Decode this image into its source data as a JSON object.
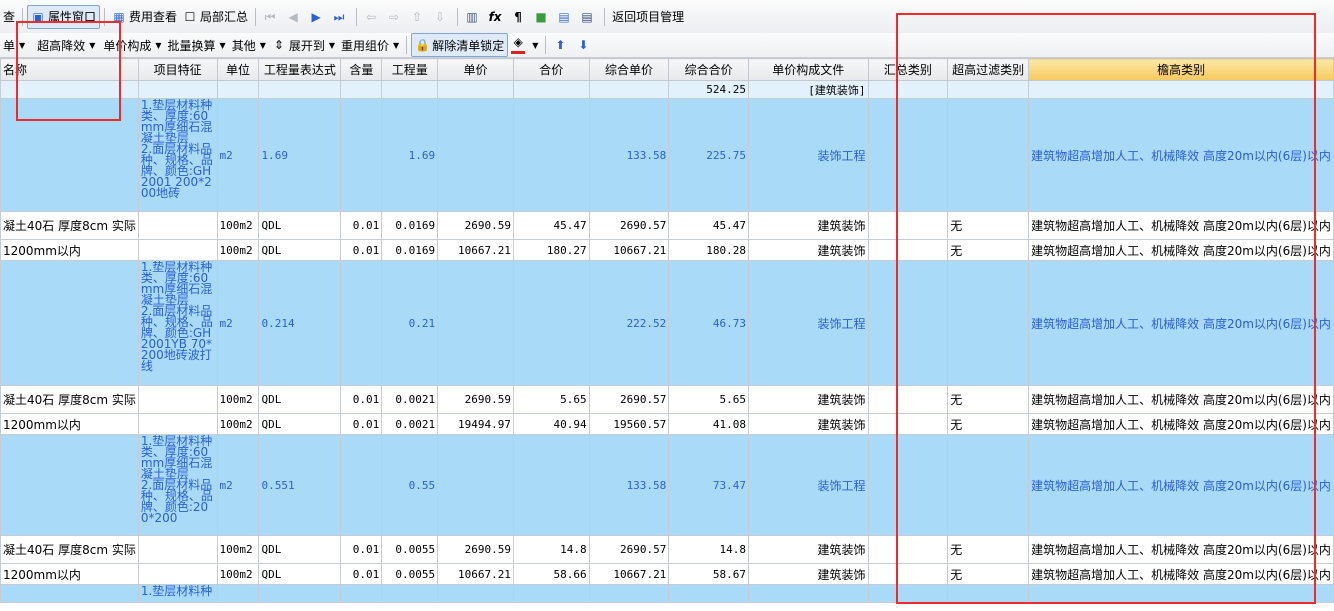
{
  "toolbar1": {
    "items": [
      {
        "label": "查"
      },
      {
        "label": "属性窗口"
      },
      {
        "label": "费用查看"
      },
      {
        "label": "局部汇总"
      },
      {
        "label": "返回项目管理"
      }
    ]
  },
  "toolbar2": {
    "items": [
      {
        "label": "单"
      },
      {
        "label": "超高降效"
      },
      {
        "label": "单价构成"
      },
      {
        "label": "批量换算"
      },
      {
        "label": "其他"
      },
      {
        "label": "展开到"
      },
      {
        "label": "重用组价"
      },
      {
        "label": "解除清单锁定"
      }
    ]
  },
  "table": {
    "headers": [
      "名称",
      "项目特征",
      "单位",
      "工程量表达式",
      "含量",
      "工程量",
      "单价",
      "合价",
      "综合单价",
      "综合合价",
      "单价构成文件",
      "汇总类别",
      "超高过滤类别",
      "檐高类别"
    ],
    "summary": [
      "",
      "",
      "",
      "",
      "",
      "",
      "",
      "",
      "",
      "524.25",
      "[建筑装饰]",
      "",
      "",
      ""
    ],
    "rows": [
      {
        "type": "blue",
        "h": 113,
        "cells": [
          "",
          "1.垫层材料种类、厚度:60mm厚细石混凝土垫层\n2.面层材料品种、规格、品牌、颜色:GH2001 200*200地砖",
          "m2",
          "1.69",
          "",
          "1.69",
          "",
          "",
          "133.58",
          "225.75",
          "装饰工程",
          "",
          "",
          "建筑物超高增加人工、机械降效 高度20m以内(6层)以内"
        ]
      },
      {
        "type": "white",
        "h": 28,
        "cells": [
          "凝土40石 厚度8cm 实际",
          "",
          "100m2",
          "QDL",
          "0.01",
          "0.0169",
          "2690.59",
          "45.47",
          "2690.57",
          "45.47",
          "建筑装饰",
          "",
          "无",
          "建筑物超高增加人工、机械降效 高度20m以内(6层)以内"
        ]
      },
      {
        "type": "white",
        "h": 21,
        "cells": [
          "1200mm以内",
          "",
          "100m2",
          "QDL",
          "0.01",
          "0.0169",
          "10667.21",
          "180.27",
          "10667.21",
          "180.28",
          "建筑装饰",
          "",
          "无",
          "建筑物超高增加人工、机械降效 高度20m以内(6层)以内"
        ]
      },
      {
        "type": "blue",
        "h": 125,
        "cells": [
          "",
          "1.垫层材料种类、厚度:60mm厚细石混凝土垫层\n2.面层材料品种、规格、品牌、颜色:GH2001YB 70*200地砖波打线",
          "m2",
          "0.214",
          "",
          "0.21",
          "",
          "",
          "222.52",
          "46.73",
          "装饰工程",
          "",
          "",
          "建筑物超高增加人工、机械降效 高度20m以内(6层)以内"
        ]
      },
      {
        "type": "white",
        "h": 28,
        "cells": [
          "凝土40石 厚度8cm 实际",
          "",
          "100m2",
          "QDL",
          "0.01",
          "0.0021",
          "2690.59",
          "5.65",
          "2690.57",
          "5.65",
          "建筑装饰",
          "",
          "无",
          "建筑物超高增加人工、机械降效 高度20m以内(6层)以内"
        ]
      },
      {
        "type": "white",
        "h": 21,
        "cells": [
          "1200mm以内",
          "",
          "100m2",
          "QDL",
          "0.01",
          "0.0021",
          "19494.97",
          "40.94",
          "19560.57",
          "41.08",
          "建筑装饰",
          "",
          "无",
          "建筑物超高增加人工、机械降效 高度20m以内(6层)以内"
        ]
      },
      {
        "type": "blue",
        "h": 101,
        "cells": [
          "",
          "1.垫层材料种类、厚度:60mm厚细石混凝土垫层\n2.面层材料品种、规格、品牌、颜色:200*200",
          "m2",
          "0.551",
          "",
          "0.55",
          "",
          "",
          "133.58",
          "73.47",
          "装饰工程",
          "",
          "",
          "建筑物超高增加人工、机械降效 高度20m以内(6层)以内"
        ]
      },
      {
        "type": "white",
        "h": 28,
        "cells": [
          "凝土40石 厚度8cm 实际",
          "",
          "100m2",
          "QDL",
          "0.01",
          "0.0055",
          "2690.59",
          "14.8",
          "2690.57",
          "14.8",
          "建筑装饰",
          "",
          "无",
          "建筑物超高增加人工、机械降效 高度20m以内(6层)以内"
        ]
      },
      {
        "type": "white",
        "h": 21,
        "cells": [
          "1200mm以内",
          "",
          "100m2",
          "QDL",
          "0.01",
          "0.0055",
          "10667.21",
          "58.66",
          "10667.21",
          "58.67",
          "建筑装饰",
          "",
          "无",
          "建筑物超高增加人工、机械降效 高度20m以内(6层)以内"
        ]
      },
      {
        "type": "blue",
        "h": 18,
        "cells": [
          "",
          "1.垫层材料种",
          "",
          "",
          "",
          "",
          "",
          "",
          "",
          "",
          "",
          "",
          "",
          ""
        ]
      }
    ]
  }
}
